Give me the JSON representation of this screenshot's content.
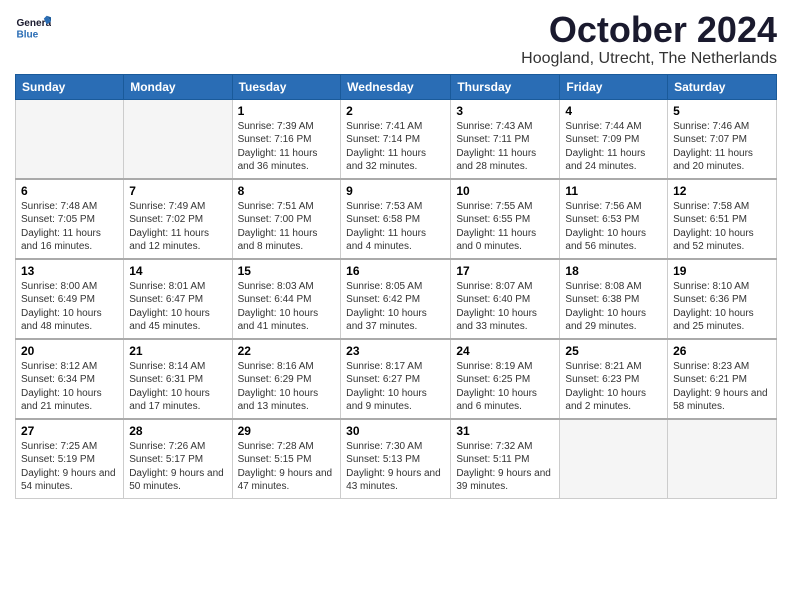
{
  "header": {
    "logo_general": "General",
    "logo_blue": "Blue",
    "title": "October 2024",
    "subtitle": "Hoogland, Utrecht, The Netherlands"
  },
  "days_of_week": [
    "Sunday",
    "Monday",
    "Tuesday",
    "Wednesday",
    "Thursday",
    "Friday",
    "Saturday"
  ],
  "weeks": [
    [
      {
        "day": "",
        "empty": true
      },
      {
        "day": "",
        "empty": true
      },
      {
        "day": "1",
        "sunrise": "Sunrise: 7:39 AM",
        "sunset": "Sunset: 7:16 PM",
        "daylight": "Daylight: 11 hours and 36 minutes."
      },
      {
        "day": "2",
        "sunrise": "Sunrise: 7:41 AM",
        "sunset": "Sunset: 7:14 PM",
        "daylight": "Daylight: 11 hours and 32 minutes."
      },
      {
        "day": "3",
        "sunrise": "Sunrise: 7:43 AM",
        "sunset": "Sunset: 7:11 PM",
        "daylight": "Daylight: 11 hours and 28 minutes."
      },
      {
        "day": "4",
        "sunrise": "Sunrise: 7:44 AM",
        "sunset": "Sunset: 7:09 PM",
        "daylight": "Daylight: 11 hours and 24 minutes."
      },
      {
        "day": "5",
        "sunrise": "Sunrise: 7:46 AM",
        "sunset": "Sunset: 7:07 PM",
        "daylight": "Daylight: 11 hours and 20 minutes."
      }
    ],
    [
      {
        "day": "6",
        "sunrise": "Sunrise: 7:48 AM",
        "sunset": "Sunset: 7:05 PM",
        "daylight": "Daylight: 11 hours and 16 minutes."
      },
      {
        "day": "7",
        "sunrise": "Sunrise: 7:49 AM",
        "sunset": "Sunset: 7:02 PM",
        "daylight": "Daylight: 11 hours and 12 minutes."
      },
      {
        "day": "8",
        "sunrise": "Sunrise: 7:51 AM",
        "sunset": "Sunset: 7:00 PM",
        "daylight": "Daylight: 11 hours and 8 minutes."
      },
      {
        "day": "9",
        "sunrise": "Sunrise: 7:53 AM",
        "sunset": "Sunset: 6:58 PM",
        "daylight": "Daylight: 11 hours and 4 minutes."
      },
      {
        "day": "10",
        "sunrise": "Sunrise: 7:55 AM",
        "sunset": "Sunset: 6:55 PM",
        "daylight": "Daylight: 11 hours and 0 minutes."
      },
      {
        "day": "11",
        "sunrise": "Sunrise: 7:56 AM",
        "sunset": "Sunset: 6:53 PM",
        "daylight": "Daylight: 10 hours and 56 minutes."
      },
      {
        "day": "12",
        "sunrise": "Sunrise: 7:58 AM",
        "sunset": "Sunset: 6:51 PM",
        "daylight": "Daylight: 10 hours and 52 minutes."
      }
    ],
    [
      {
        "day": "13",
        "sunrise": "Sunrise: 8:00 AM",
        "sunset": "Sunset: 6:49 PM",
        "daylight": "Daylight: 10 hours and 48 minutes."
      },
      {
        "day": "14",
        "sunrise": "Sunrise: 8:01 AM",
        "sunset": "Sunset: 6:47 PM",
        "daylight": "Daylight: 10 hours and 45 minutes."
      },
      {
        "day": "15",
        "sunrise": "Sunrise: 8:03 AM",
        "sunset": "Sunset: 6:44 PM",
        "daylight": "Daylight: 10 hours and 41 minutes."
      },
      {
        "day": "16",
        "sunrise": "Sunrise: 8:05 AM",
        "sunset": "Sunset: 6:42 PM",
        "daylight": "Daylight: 10 hours and 37 minutes."
      },
      {
        "day": "17",
        "sunrise": "Sunrise: 8:07 AM",
        "sunset": "Sunset: 6:40 PM",
        "daylight": "Daylight: 10 hours and 33 minutes."
      },
      {
        "day": "18",
        "sunrise": "Sunrise: 8:08 AM",
        "sunset": "Sunset: 6:38 PM",
        "daylight": "Daylight: 10 hours and 29 minutes."
      },
      {
        "day": "19",
        "sunrise": "Sunrise: 8:10 AM",
        "sunset": "Sunset: 6:36 PM",
        "daylight": "Daylight: 10 hours and 25 minutes."
      }
    ],
    [
      {
        "day": "20",
        "sunrise": "Sunrise: 8:12 AM",
        "sunset": "Sunset: 6:34 PM",
        "daylight": "Daylight: 10 hours and 21 minutes."
      },
      {
        "day": "21",
        "sunrise": "Sunrise: 8:14 AM",
        "sunset": "Sunset: 6:31 PM",
        "daylight": "Daylight: 10 hours and 17 minutes."
      },
      {
        "day": "22",
        "sunrise": "Sunrise: 8:16 AM",
        "sunset": "Sunset: 6:29 PM",
        "daylight": "Daylight: 10 hours and 13 minutes."
      },
      {
        "day": "23",
        "sunrise": "Sunrise: 8:17 AM",
        "sunset": "Sunset: 6:27 PM",
        "daylight": "Daylight: 10 hours and 9 minutes."
      },
      {
        "day": "24",
        "sunrise": "Sunrise: 8:19 AM",
        "sunset": "Sunset: 6:25 PM",
        "daylight": "Daylight: 10 hours and 6 minutes."
      },
      {
        "day": "25",
        "sunrise": "Sunrise: 8:21 AM",
        "sunset": "Sunset: 6:23 PM",
        "daylight": "Daylight: 10 hours and 2 minutes."
      },
      {
        "day": "26",
        "sunrise": "Sunrise: 8:23 AM",
        "sunset": "Sunset: 6:21 PM",
        "daylight": "Daylight: 9 hours and 58 minutes."
      }
    ],
    [
      {
        "day": "27",
        "sunrise": "Sunrise: 7:25 AM",
        "sunset": "Sunset: 5:19 PM",
        "daylight": "Daylight: 9 hours and 54 minutes."
      },
      {
        "day": "28",
        "sunrise": "Sunrise: 7:26 AM",
        "sunset": "Sunset: 5:17 PM",
        "daylight": "Daylight: 9 hours and 50 minutes."
      },
      {
        "day": "29",
        "sunrise": "Sunrise: 7:28 AM",
        "sunset": "Sunset: 5:15 PM",
        "daylight": "Daylight: 9 hours and 47 minutes."
      },
      {
        "day": "30",
        "sunrise": "Sunrise: 7:30 AM",
        "sunset": "Sunset: 5:13 PM",
        "daylight": "Daylight: 9 hours and 43 minutes."
      },
      {
        "day": "31",
        "sunrise": "Sunrise: 7:32 AM",
        "sunset": "Sunset: 5:11 PM",
        "daylight": "Daylight: 9 hours and 39 minutes."
      },
      {
        "day": "",
        "empty": true
      },
      {
        "day": "",
        "empty": true
      }
    ]
  ]
}
